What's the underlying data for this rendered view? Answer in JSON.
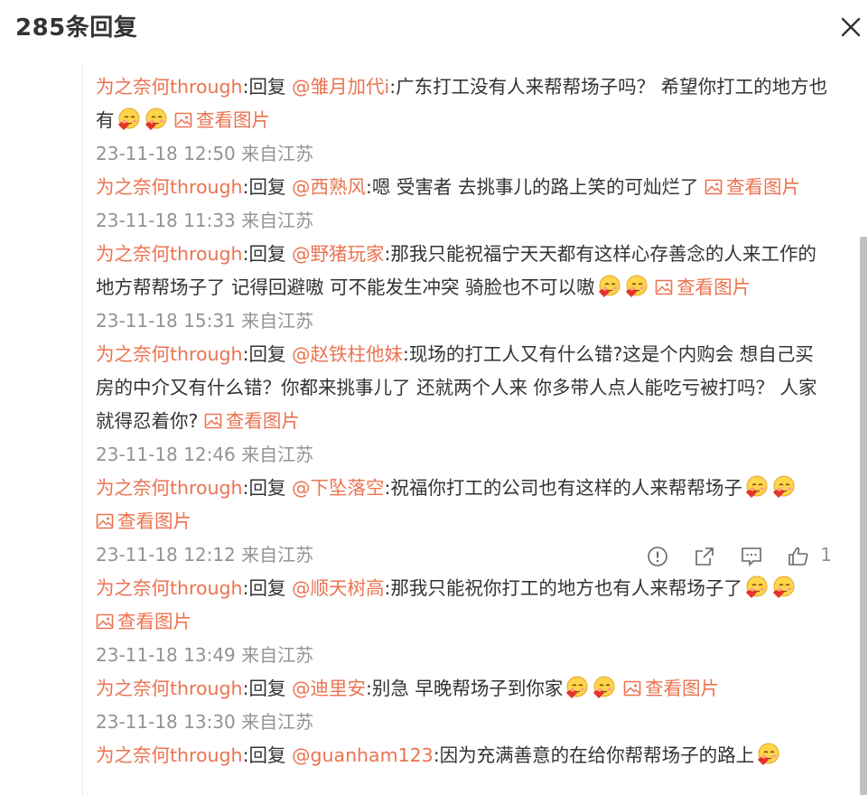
{
  "header": {
    "title": "285条回复"
  },
  "icons": {
    "close": "close-icon",
    "image": "image-icon",
    "emoji": "blush-emoji-icon",
    "report": "report-icon",
    "share": "share-icon",
    "comment": "comment-icon",
    "like": "like-icon"
  },
  "colors": {
    "link": "#eb7350",
    "meta": "#939393",
    "text": "#333333"
  },
  "replies": [
    {
      "user": "为之奈何through",
      "sep": ":回复 ",
      "at": "@雏月加代i",
      "text": ":广东打工没有人来帮帮场子吗？  希望你打工的地方也有",
      "emojis": 2,
      "view_image": "查看图片",
      "meta": "23-11-18 12:50 来自江苏"
    },
    {
      "user": "为之奈何through",
      "sep": ":回复 ",
      "at": "@西熟风",
      "text": ":嗯 受害者 去挑事儿的路上笑的可灿烂了 ",
      "emojis": 0,
      "view_image": "查看图片",
      "meta": "23-11-18 11:33 来自江苏"
    },
    {
      "user": "为之奈何through",
      "sep": ":回复 ",
      "at": "@野猪玩家",
      "text": ":那我只能祝福宁天天都有这样心存善念的人来工作的地方帮帮场子了 记得回避嗷 可不能发生冲突 骑脸也不可以嗷",
      "emojis": 2,
      "view_image": "查看图片",
      "meta": "23-11-18 15:31 来自江苏"
    },
    {
      "user": "为之奈何through",
      "sep": ":回复 ",
      "at": "@赵铁柱他妹",
      "text": ":现场的打工人又有什么错?这是个内购会 想自己买房的中介又有什么错？你都来挑事儿了 还就两个人来 你多带人点人能吃亏被打吗？ 人家就得忍着你? ",
      "emojis": 0,
      "view_image": "查看图片",
      "meta": "23-11-18 12:46 来自江苏"
    },
    {
      "user": "为之奈何through",
      "sep": ":回复 ",
      "at": "@下坠落空",
      "text": ":祝福你打工的公司也有这样的人来帮帮场子",
      "emojis": 2,
      "view_image": "查看图片",
      "meta": "23-11-18 12:12 来自江苏",
      "like_count": "1"
    },
    {
      "user": "为之奈何through",
      "sep": ":回复 ",
      "at": "@顺天树高",
      "text": ":那我只能祝你打工的地方也有人来帮场子了",
      "emojis": 2,
      "view_image": "查看图片",
      "meta": "23-11-18 13:49 来自江苏"
    },
    {
      "user": "为之奈何through",
      "sep": ":回复 ",
      "at": "@迪里安",
      "text": ":别急 早晚帮场子到你家",
      "emojis": 2,
      "view_image": "查看图片",
      "meta": "23-11-18 13:30 来自江苏"
    },
    {
      "user": "为之奈何through",
      "sep": ":回复 ",
      "at": "@guanham123",
      "text": ":因为充满善意的在给你帮帮场子的路上",
      "emojis": 1,
      "view_image": "",
      "meta": ""
    }
  ]
}
